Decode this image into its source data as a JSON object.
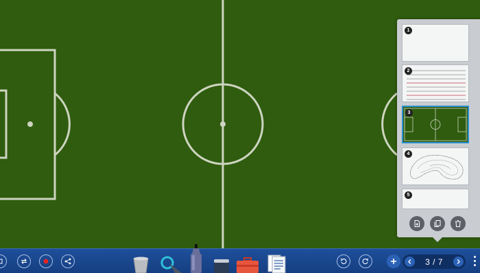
{
  "canvas": {
    "background": "field-green",
    "field_color": "#2f5c0e",
    "line_color": "#cdd4c0"
  },
  "page_panel": {
    "pages": [
      {
        "number": "1",
        "content": "blank-page"
      },
      {
        "number": "2",
        "content": "lined-page"
      },
      {
        "number": "3",
        "content": "soccer-field",
        "selected": true
      },
      {
        "number": "4",
        "content": "sketch-drawing"
      },
      {
        "number": "5",
        "content": "blank-page"
      }
    ],
    "actions": [
      "new-page-icon",
      "copy-page-icon",
      "delete-page-icon"
    ]
  },
  "toolbar": {
    "left_buttons": [
      "screenshot-icon",
      "switch-icon",
      "record-icon",
      "share-icon"
    ],
    "tools": [
      "bucket-tool",
      "selection-pointer-tool",
      "pen-tool",
      "eraser-tool",
      "toolbox-tool",
      "document-tool"
    ],
    "undo_redo": [
      "undo-icon",
      "redo-icon"
    ],
    "page_nav": {
      "current_page": 3,
      "total_pages": 7,
      "label": "3 / 7"
    },
    "accent_color": "#1e4f9a"
  }
}
